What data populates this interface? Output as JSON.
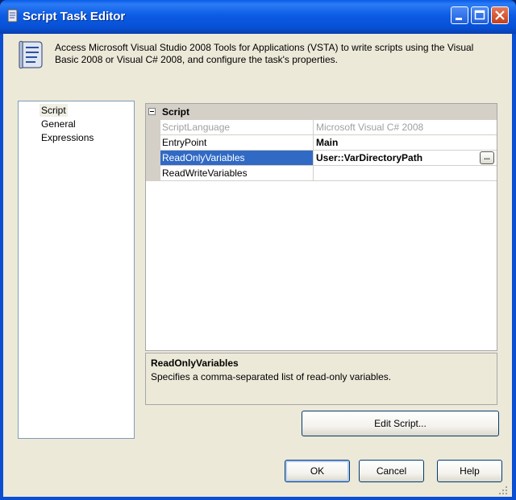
{
  "window": {
    "title": "Script Task Editor"
  },
  "header": {
    "description": "Access Microsoft Visual Studio 2008 Tools for Applications (VSTA) to write scripts using the Visual Basic 2008 or Visual C# 2008, and configure the task's properties.",
    "icon": "script-scroll-icon"
  },
  "nav": {
    "items": [
      "Script",
      "General",
      "Expressions"
    ],
    "selected": "Script"
  },
  "grid": {
    "category": "Script",
    "rows": [
      {
        "name": "ScriptLanguage",
        "value": "Microsoft Visual C# 2008"
      },
      {
        "name": "EntryPoint",
        "value": "Main"
      },
      {
        "name": "ReadOnlyVariables",
        "value": "User::VarDirectoryPath",
        "ellipsis": "..."
      },
      {
        "name": "ReadWriteVariables",
        "value": ""
      }
    ]
  },
  "help": {
    "title": "ReadOnlyVariables",
    "text": "Specifies a comma-separated list of read-only variables."
  },
  "buttons": {
    "edit_script": "Edit Script...",
    "ok": "OK",
    "cancel": "Cancel",
    "help": "Help"
  },
  "colors": {
    "titlebar": "#0a5ce8",
    "selection": "#316ac5",
    "dialog_bg": "#ece9d8"
  }
}
